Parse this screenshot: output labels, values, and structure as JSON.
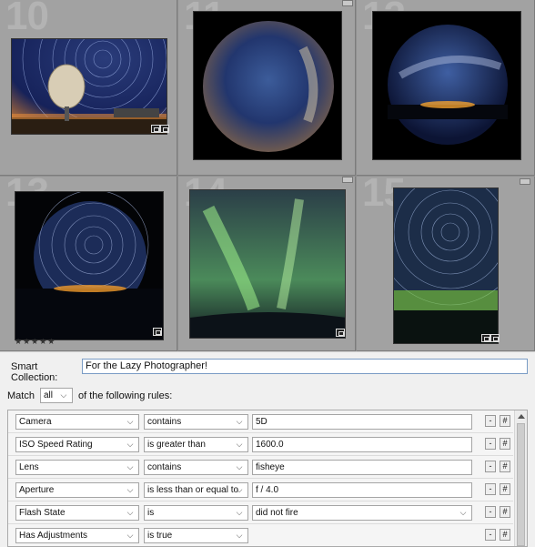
{
  "grid": {
    "cells": [
      {
        "number": "10",
        "stars": "",
        "flag": false
      },
      {
        "number": "11",
        "stars": "",
        "flag": true
      },
      {
        "number": "12",
        "stars": "",
        "flag": false
      },
      {
        "number": "13",
        "stars": "★★★★★",
        "flag": false
      },
      {
        "number": "14",
        "stars": "",
        "flag": true
      },
      {
        "number": "15",
        "stars": "",
        "flag": true
      }
    ]
  },
  "dialog": {
    "smart_collection_label": "Smart Collection:",
    "smart_collection_value": "For the Lazy Photographer!",
    "match_label": "Match",
    "match_value": "all",
    "match_suffix": "of the following rules:",
    "rules": [
      {
        "field": "Camera",
        "operator": "contains",
        "value": "5D",
        "value_type": "text"
      },
      {
        "field": "ISO Speed Rating",
        "operator": "is greater than",
        "value": "1600.0",
        "value_type": "text"
      },
      {
        "field": "Lens",
        "operator": "contains",
        "value": "fisheye",
        "value_type": "text"
      },
      {
        "field": "Aperture",
        "operator": "is less than or equal to",
        "value": "f / 4.0",
        "value_type": "text"
      },
      {
        "field": "Flash State",
        "operator": "is",
        "value": "did not fire",
        "value_type": "select"
      },
      {
        "field": "Has Adjustments",
        "operator": "is true",
        "value": "",
        "value_type": "none"
      }
    ],
    "minus_label": "-",
    "plus_label": "#"
  },
  "icons": {
    "chevron": "chevron-down-icon",
    "badge": "photo-badge-icon"
  }
}
